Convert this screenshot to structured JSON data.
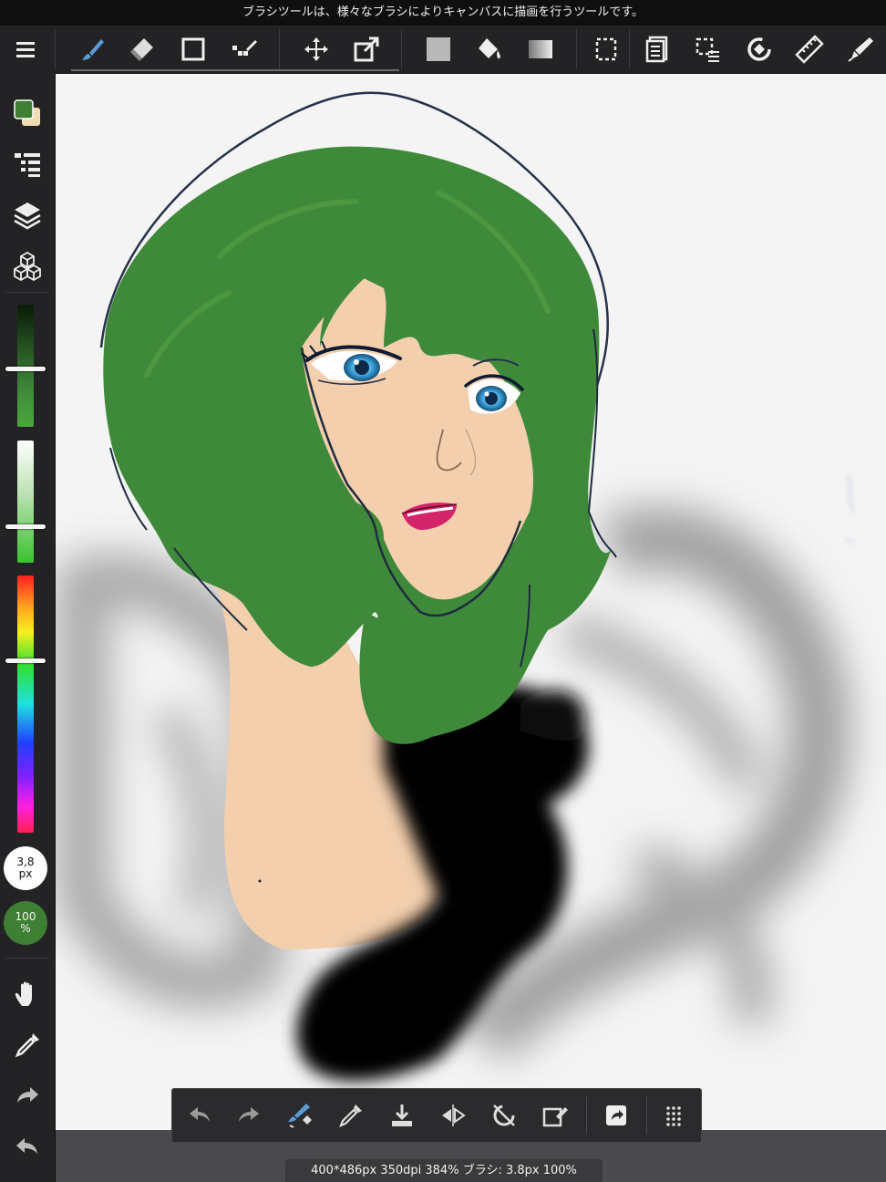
{
  "tooltip": "ブラシツールは、様々なブラシによりキャンバスに描画を行うツールです。",
  "status": "400*486px 350dpi 384% ブラシ: 3.8px 100%",
  "brush_size": {
    "value": "3,8",
    "unit": "px"
  },
  "brush_opacity": {
    "value": "100",
    "unit": "%"
  },
  "colors": {
    "foreground": "#3f7f34",
    "background": "#f2dcb4",
    "skin": "#f3cfae",
    "hair": "#3f8a3a",
    "accent_active": "#5b9bd5"
  },
  "toolbar_icons": [
    "menu-icon",
    "brush-icon",
    "eraser-icon",
    "shape-icon",
    "dot-icon",
    "move-icon",
    "transform-icon",
    "fill-color-icon",
    "bucket-icon",
    "gradient-icon",
    "select-icon",
    "layer-menu-icon",
    "select-menu-icon",
    "rotate-icon",
    "ruler-icon",
    "pen-cursor-icon"
  ],
  "sidebar_icons": [
    "color-swatch-icon",
    "layer-list-icon",
    "layers-icon",
    "3d-cubes-icon",
    "hand-icon",
    "eyedropper-icon",
    "redo-icon",
    "undo-icon"
  ],
  "action_icons": [
    "undo-icon",
    "redo-icon",
    "brush-select-icon",
    "eyedropper-icon",
    "download-icon",
    "flip-icon",
    "rotate-off-icon",
    "clear-icon",
    "export-icon",
    "grid-icon"
  ],
  "sliders": {
    "value_level": 0.52,
    "saturation_level": 0.7,
    "hue_level": 0.33
  }
}
